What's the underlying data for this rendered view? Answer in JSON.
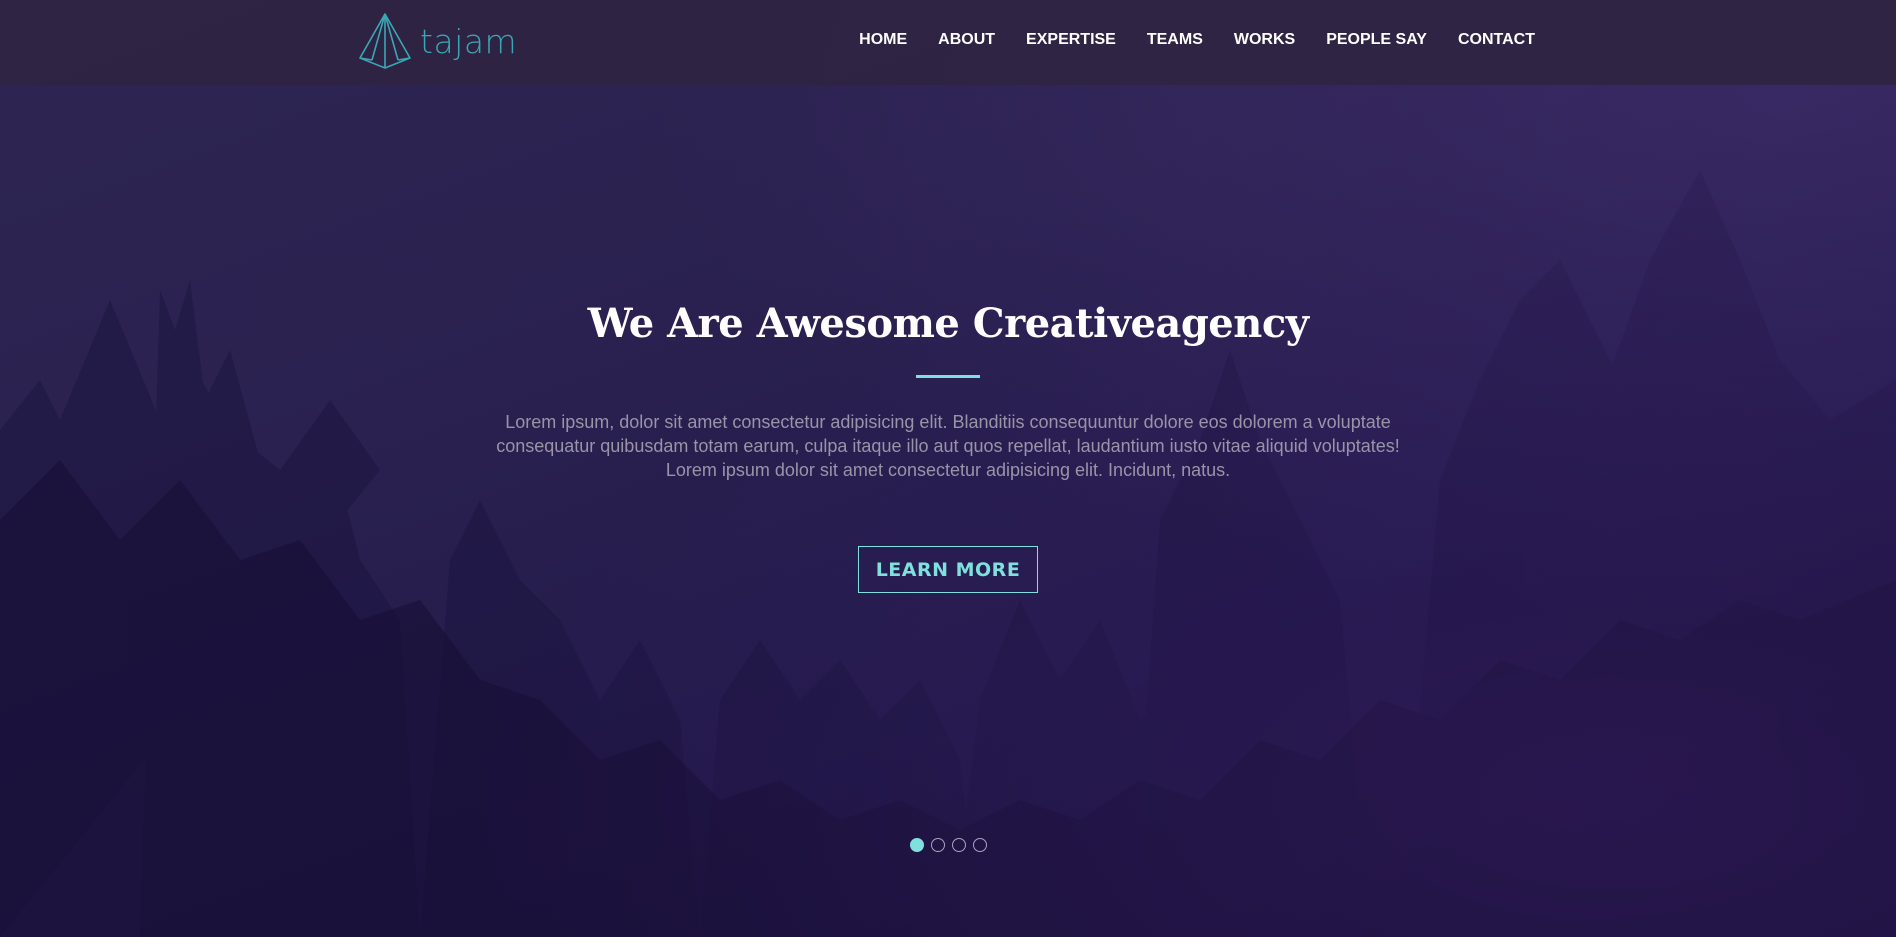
{
  "brand": {
    "name": "tajam",
    "logo_icon": "pyramid-icon",
    "color": "#3aa7b4"
  },
  "nav": {
    "items": [
      {
        "label": "HOME"
      },
      {
        "label": "ABOUT"
      },
      {
        "label": "EXPERTISE"
      },
      {
        "label": "TEAMS"
      },
      {
        "label": "WORKS"
      },
      {
        "label": "PEOPLE SAY"
      },
      {
        "label": "CONTACT"
      }
    ]
  },
  "hero": {
    "title": "We Are Awesome Creativeagency",
    "description": "Lorem ipsum, dolor sit amet consectetur adipisicing elit. Blanditiis consequuntur dolore eos dolorem a voluptate consequatur quibusdam totam earum, culpa itaque illo aut quos repellat, laudantium iusto vitae aliquid voluptates! Lorem ipsum dolor sit amet consectetur adipisicing elit. Incidunt, natus.",
    "button_label": "LEARN MORE"
  },
  "slider": {
    "count": 4,
    "active_index": 0
  },
  "colors": {
    "accent": "#7fe0dd",
    "navbar": "#302442",
    "background": "#22194a"
  }
}
